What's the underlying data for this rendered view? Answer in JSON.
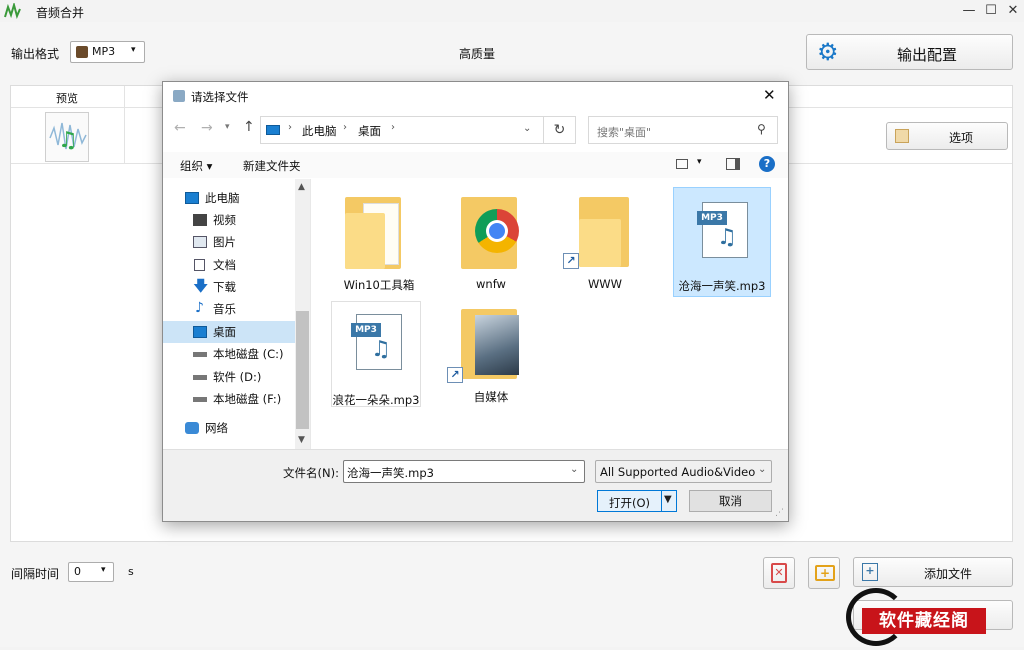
{
  "app": {
    "title": "音频合并",
    "output_format_label": "输出格式",
    "output_format_value": "MP3",
    "quality_label": "高质量",
    "output_config_label": "输出配置",
    "preview_col": "预览",
    "options_label": "选项",
    "interval_label": "间隔时间",
    "interval_value": "0",
    "interval_unit": "s",
    "add_file_label": "添加文件"
  },
  "dialog": {
    "title": "请选择文件",
    "breadcrumb": [
      "此电脑",
      "桌面"
    ],
    "search_placeholder": "搜索\"桌面\"",
    "organize_label": "组织 ▾",
    "new_folder_label": "新建文件夹",
    "tree": [
      {
        "label": "此电脑",
        "icon": "computer-icon"
      },
      {
        "label": "视频",
        "icon": "video-icon"
      },
      {
        "label": "图片",
        "icon": "picture-icon"
      },
      {
        "label": "文档",
        "icon": "document-icon"
      },
      {
        "label": "下载",
        "icon": "download-icon"
      },
      {
        "label": "音乐",
        "icon": "music-icon"
      },
      {
        "label": "桌面",
        "icon": "desktop-icon"
      },
      {
        "label": "本地磁盘 (C:)",
        "icon": "drive-icon"
      },
      {
        "label": "软件 (D:)",
        "icon": "drive-icon"
      },
      {
        "label": "本地磁盘 (F:)",
        "icon": "drive-icon"
      },
      {
        "label": "网络",
        "icon": "network-icon"
      }
    ],
    "files": [
      {
        "name": "Win10工具箱",
        "type": "folder"
      },
      {
        "name": "wnfw",
        "type": "folder-chrome"
      },
      {
        "name": "WWW",
        "type": "folder-shortcut"
      },
      {
        "name": "沧海一声笑.mp3",
        "type": "mp3",
        "selected": true
      },
      {
        "name": "浪花一朵朵.mp3",
        "type": "mp3"
      },
      {
        "name": "自媒体",
        "type": "folder-shortcut-image"
      }
    ],
    "filename_label": "文件名(N):",
    "filename_value": "沧海一声笑.mp3",
    "filter_value": "All Supported Audio&Video",
    "open_label": "打开(O)",
    "cancel_label": "取消"
  },
  "watermark": {
    "text": "软件藏经阁"
  }
}
